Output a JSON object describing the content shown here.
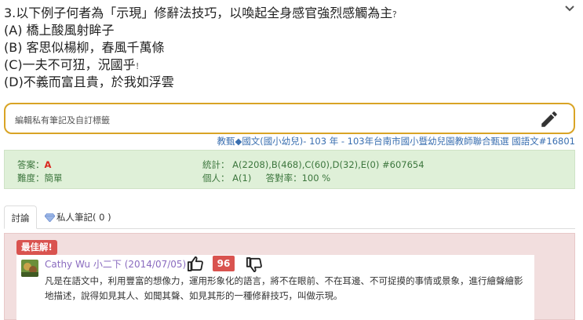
{
  "question": {
    "title": "3.以下例子何者為「示現」修辭法技巧，以喚起全身感官強烈感觸為主",
    "title_tail": "？",
    "options": [
      {
        "label": "(A) 橋上酸風射眸子",
        "tail": ""
      },
      {
        "label": "(B) 客思似楊柳，春風千萬條",
        "tail": ""
      },
      {
        "label": "(C)一夫不可狃，況國乎",
        "tail": "！"
      },
      {
        "label": "(D)不義而富且貴，於我如浮雲",
        "tail": ""
      }
    ]
  },
  "note": {
    "placeholder": "編輯私有筆記及自訂標籤"
  },
  "meta": {
    "subject": "教甄◆國文(國小幼兒)",
    "sep1": "- 103 年 - ",
    "exam": "103年台南市國小暨幼兒園教師聯合甄選 國語文#16801"
  },
  "stats": {
    "answer_label": "答案：",
    "answer_value": "A",
    "difficulty": "難度：簡單",
    "stat_line": "統計： A(2208),B(468),C(60),D(32),E(0) #607654",
    "personal_label": "個人： A(1)",
    "accuracy": "答對率：100 %"
  },
  "tabs": {
    "discussion": "討論",
    "private_notes": "私人筆記( 0 )"
  },
  "best_answer": {
    "badge": "最佳解!",
    "author": "Cathy Wu",
    "grade": "小二下",
    "date": "(2014/07/05)",
    "votes": "96",
    "body": "凡是在語文中，利用豐富的想像力，運用形象化的語言，將不在眼前、不在耳邊、不可捉摸的事情或景象，進行繪聲繪影地描述，說得如見其人、如聞其聲、如見其形的一種修辭技巧，叫做示現。"
  },
  "colors": {
    "accent_border": "#d9a425",
    "success_bg": "#dff0d8",
    "danger": "#d9534f",
    "link": "#3a6fb0"
  }
}
